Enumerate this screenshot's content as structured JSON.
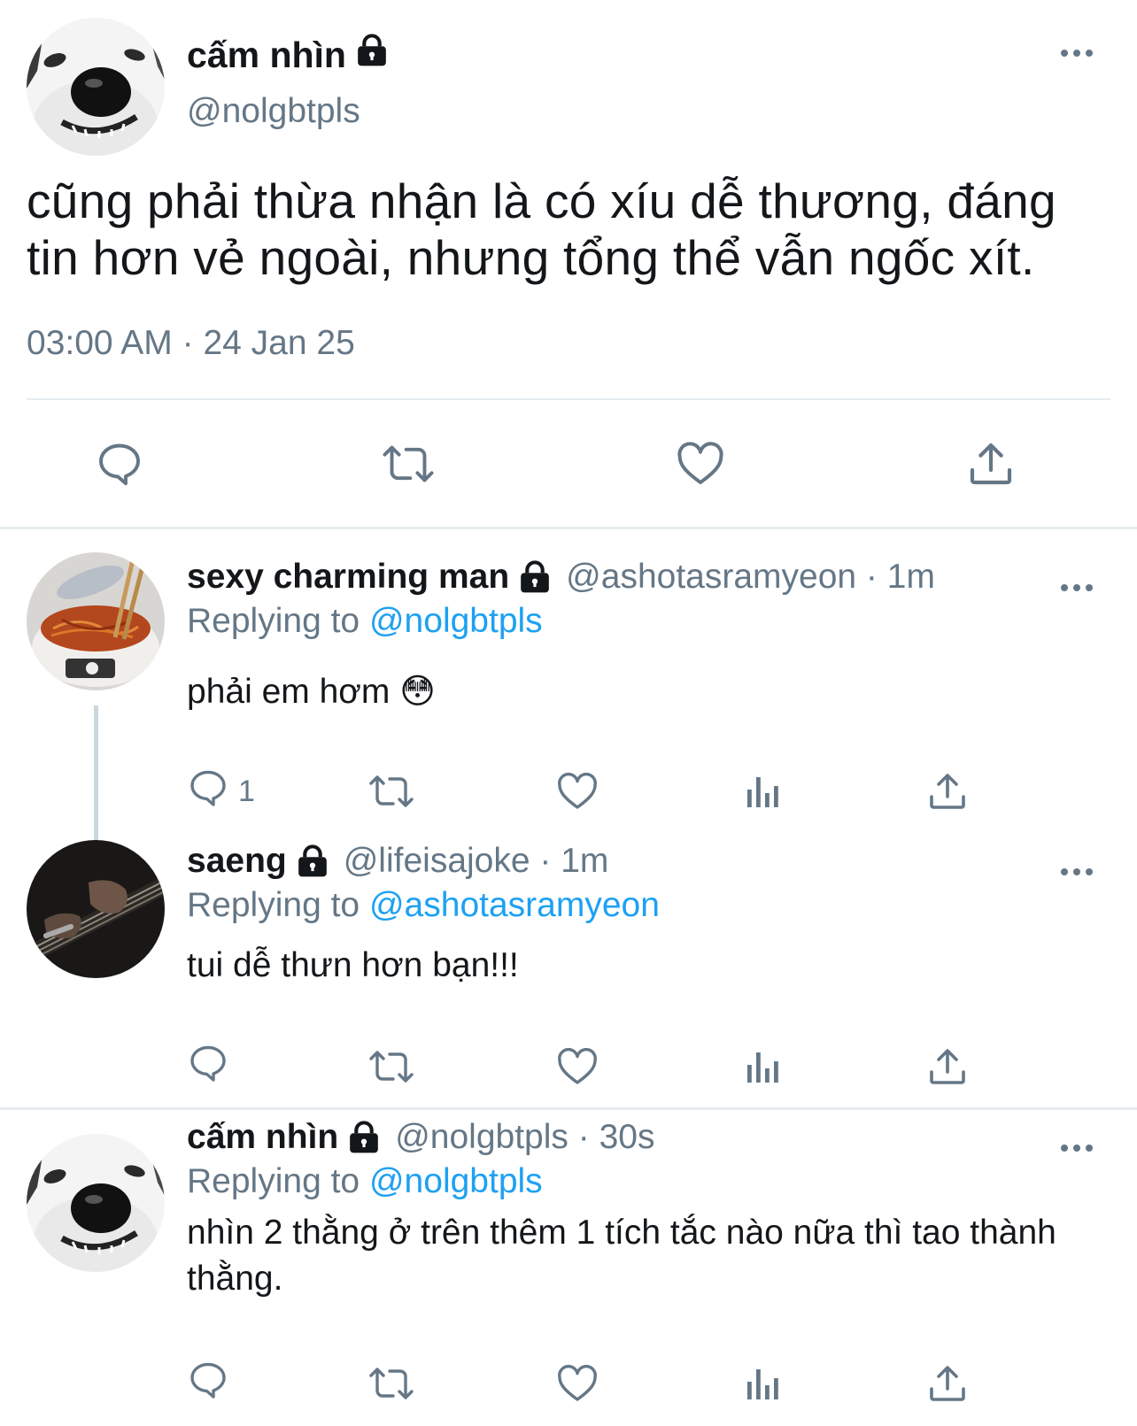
{
  "main": {
    "name": "cấm nhìn",
    "handle": "@nolgbtpls",
    "text": "cũng phải thừa nhận là có xíu dễ thương, đáng tin hơn vẻ ngoài, nhưng tổng thể vẫn ngốc xít.",
    "time": "03:00 AM",
    "separator": "·",
    "date": "24 Jan 25"
  },
  "replies": [
    {
      "name": "sexy charming man",
      "handle": "@ashotasramyeon",
      "sep": " · ",
      "ago": "1m",
      "replying_prefix": "Replying to",
      "replying_to": "@nolgbtpls",
      "text": "phải em hơm 😳",
      "reply_count": "1"
    },
    {
      "name": "saeng",
      "handle": "@lifeisajoke",
      "sep": " · ",
      "ago": "1m",
      "replying_prefix": "Replying to",
      "replying_to": "@ashotasramyeon",
      "text": "tui dễ thưn hơn bạn!!!",
      "reply_count": ""
    },
    {
      "name": "cấm nhìn",
      "handle": "@nolgbtpls",
      "sep": " · ",
      "ago": "30s",
      "replying_prefix": "Replying to",
      "replying_to": "@nolgbtpls",
      "text": "nhìn 2 thằng ở trên thêm 1 tích tắc nào nữa thì tao thành thằng.",
      "reply_count": ""
    }
  ],
  "icons": {
    "lock": "lock-icon",
    "more": "more-icon",
    "reply": "reply-icon",
    "retweet": "retweet-icon",
    "like": "heart-icon",
    "share": "share-icon",
    "analytics": "analytics-icon"
  },
  "colors": {
    "text": "#14171a",
    "muted": "#657786",
    "link": "#1da1f2",
    "divider": "#e6ecf0",
    "thread_line": "#ccd6dd"
  }
}
